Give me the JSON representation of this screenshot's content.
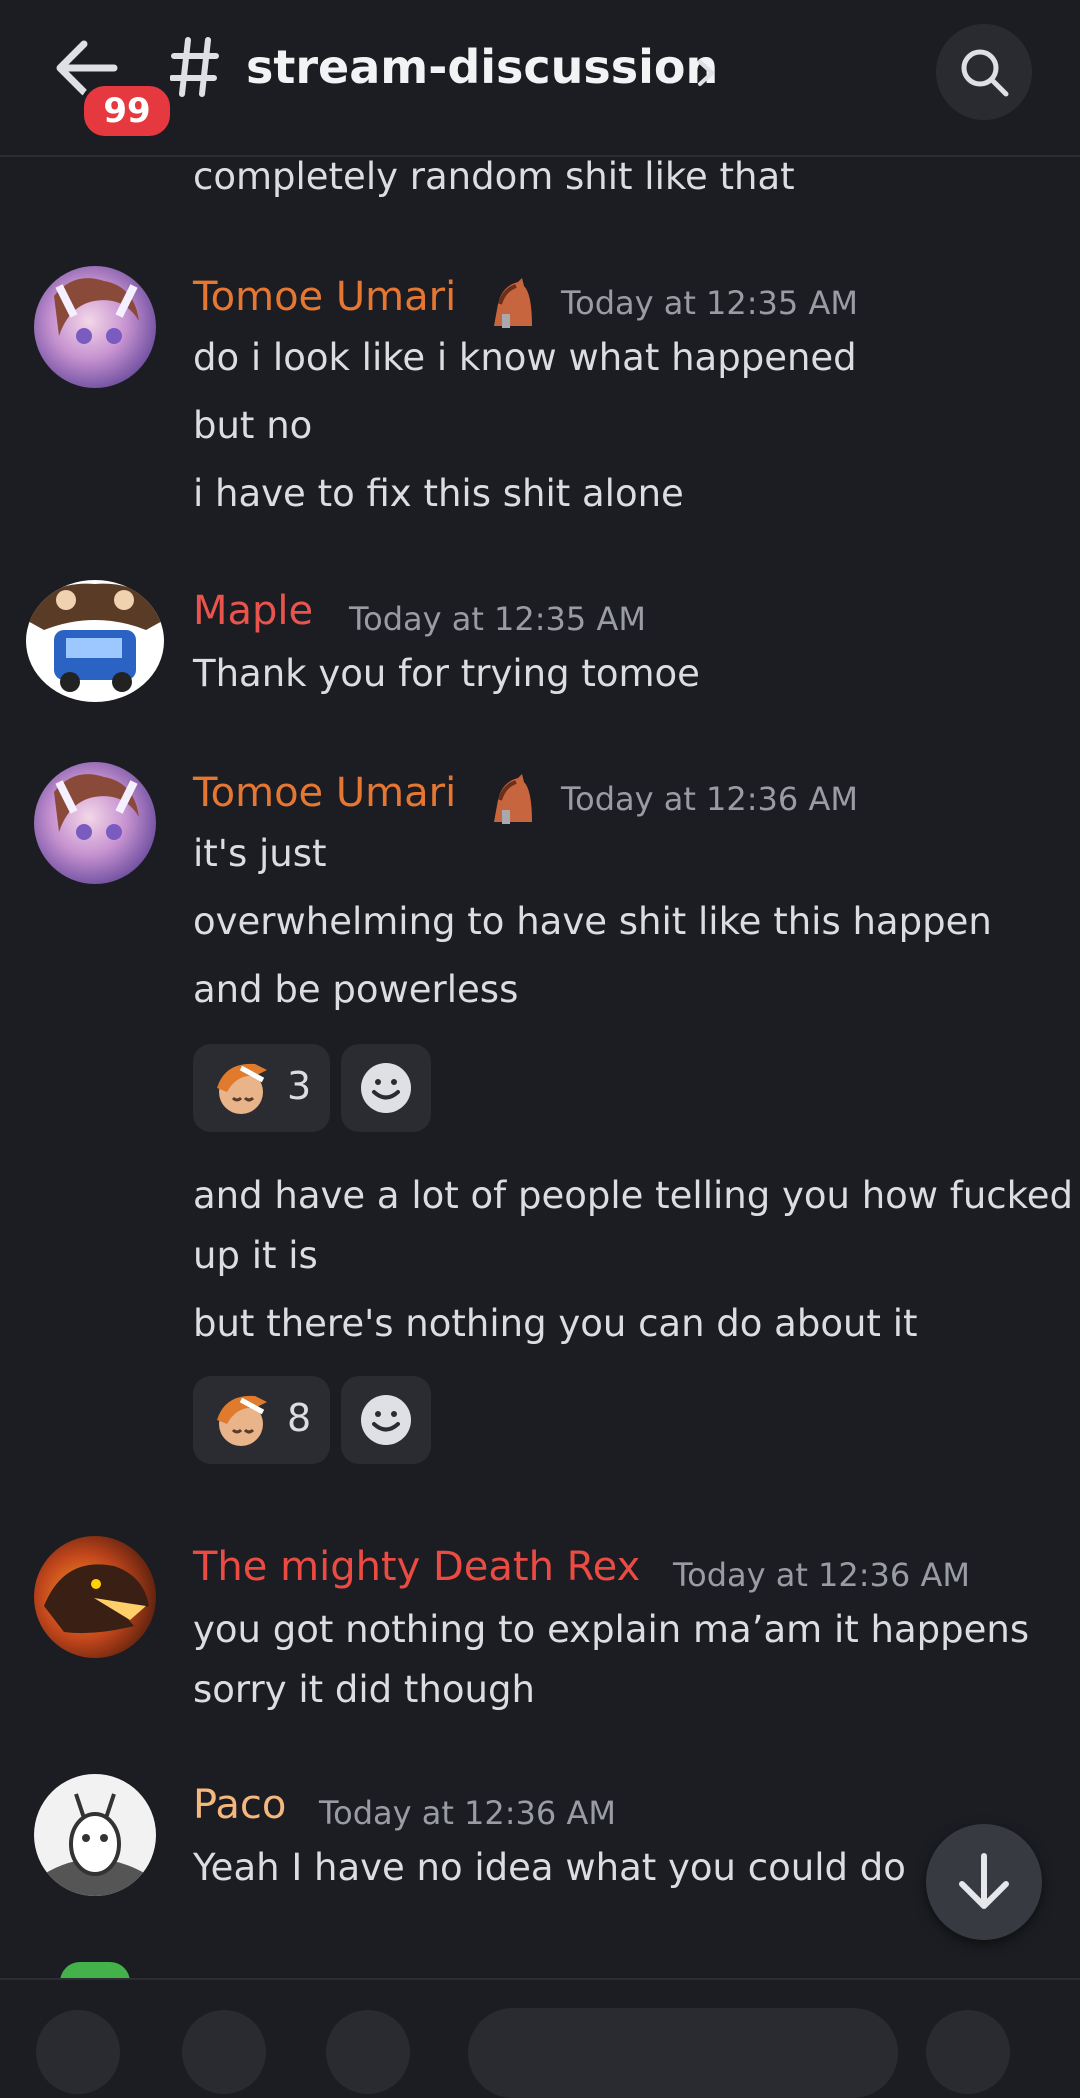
{
  "header": {
    "back_badge": "99",
    "channel_name": "stream-discussion"
  },
  "messages": {
    "cont0": "completely random shit like that",
    "m1": {
      "author": "Tomoe Umari",
      "author_color": "#e67733",
      "timestamp": "Today at 12:35 AM",
      "lines": [
        "do i look like i know what happened",
        "but no",
        "i have to fix this shit alone"
      ]
    },
    "m2": {
      "author": "Maple",
      "author_color": "#e9544c",
      "timestamp": "Today at 12:35 AM",
      "lines": [
        "Thank you for trying tomoe"
      ]
    },
    "m3": {
      "author": "Tomoe Umari",
      "author_color": "#e67733",
      "timestamp": "Today at 12:36 AM",
      "lines": [
        "it's just",
        "overwhelming to have shit like this happen",
        "and be powerless"
      ],
      "reaction1_count": "3",
      "lines2": [
        "and have a lot of people telling you how fucked",
        "up it is",
        "but there's nothing you can do about it"
      ],
      "reaction2_count": "8"
    },
    "m4": {
      "author": "The mighty Death Rex",
      "author_color": "#ec4b43",
      "timestamp": "Today at 12:36 AM",
      "lines": [
        "you got nothing to explain ma’am it happens",
        "sorry it did though"
      ]
    },
    "m5": {
      "author": "Paco",
      "author_color": "#f4b87e",
      "timestamp": "Today at 12:36 AM",
      "lines": [
        "Yeah I have no idea what you could do"
      ]
    }
  },
  "icons": {
    "back": "arrow-left-icon",
    "channel": "hash-icon",
    "search": "search-icon",
    "scroll_down": "arrow-down-icon",
    "role": "horse-icon"
  }
}
